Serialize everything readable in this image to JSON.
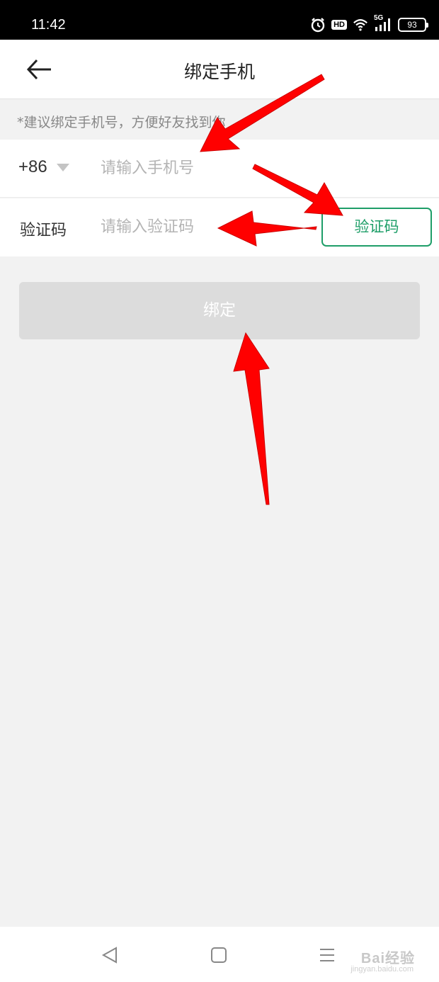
{
  "status_bar": {
    "time": "11:42",
    "hd": "HD",
    "network": "5G",
    "battery": "93",
    "icons": [
      "alarm-icon",
      "wifi-icon",
      "signal-icon",
      "battery-icon"
    ]
  },
  "header": {
    "title": "绑定手机",
    "back_icon": "arrow-left-icon"
  },
  "hint": "*建议绑定手机号，方便好友找到你",
  "phone_row": {
    "country_code": "+86",
    "placeholder": "请输入手机号"
  },
  "code_row": {
    "label": "验证码",
    "placeholder": "请输入验证码",
    "button": "验证码"
  },
  "bind_button": "绑定",
  "colors": {
    "accent": "#1e9e68",
    "disabled_button": "#dcdcdc",
    "background": "#f2f2f2",
    "annotation_arrow": "#ff0000"
  },
  "watermark": {
    "main": "Bai经验",
    "sub": "jingyan.baidu.com"
  }
}
